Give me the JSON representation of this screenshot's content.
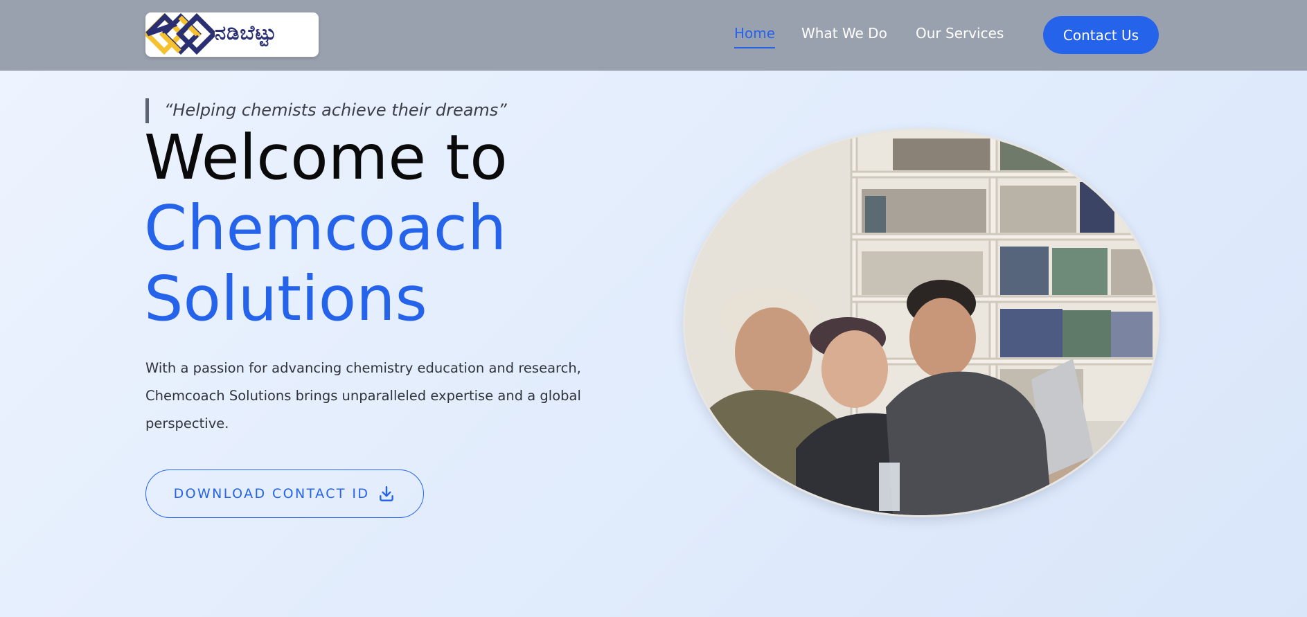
{
  "header": {
    "logo_text": "ನಡಿಬೆಟ್ಟು",
    "nav": [
      {
        "label": "Home",
        "active": true
      },
      {
        "label": "What We Do",
        "active": false
      },
      {
        "label": "Our Services",
        "active": false
      }
    ],
    "contact_label": "Contact Us"
  },
  "hero": {
    "quote": "“Helping chemists achieve their dreams”",
    "title_line1": "Welcome to",
    "title_line2": "Chemcoach",
    "title_line3": "Solutions",
    "description": "With a passion for advancing chemistry education and research, Chemcoach Solutions brings unparalleled expertise and a global perspective.",
    "download_label": "DOWNLOAD CONTACT ID"
  },
  "icons": {
    "logo": "diamond-logo-icon",
    "download": "download-icon"
  },
  "colors": {
    "accent": "#2563eb",
    "header_bg": "#9aa1ae",
    "logo_navy": "#2a2f72",
    "logo_yellow": "#f5c12e"
  }
}
